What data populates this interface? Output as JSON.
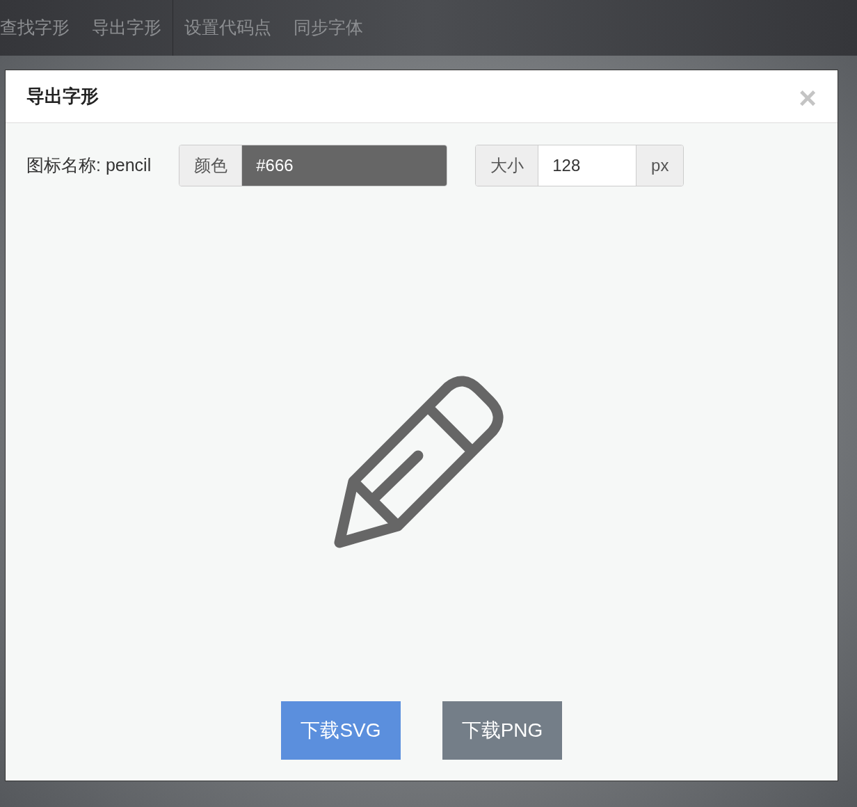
{
  "nav": {
    "groups": [
      [
        {
          "label": "查找字形"
        },
        {
          "label": "导出字形"
        }
      ],
      [
        {
          "label": "设置代码点"
        },
        {
          "label": "同步字体"
        }
      ]
    ]
  },
  "dialog": {
    "title": "导出字形",
    "close": "×",
    "icon_name": {
      "label": "图标名称:",
      "value": "pencil"
    },
    "color": {
      "label": "颜色",
      "value": "#666"
    },
    "size": {
      "label": "大小",
      "value": "128",
      "unit": "px"
    },
    "buttons": [
      {
        "label": "下载SVG",
        "kind": "primary"
      },
      {
        "label": "下载PNG",
        "kind": "secondary"
      }
    ]
  }
}
